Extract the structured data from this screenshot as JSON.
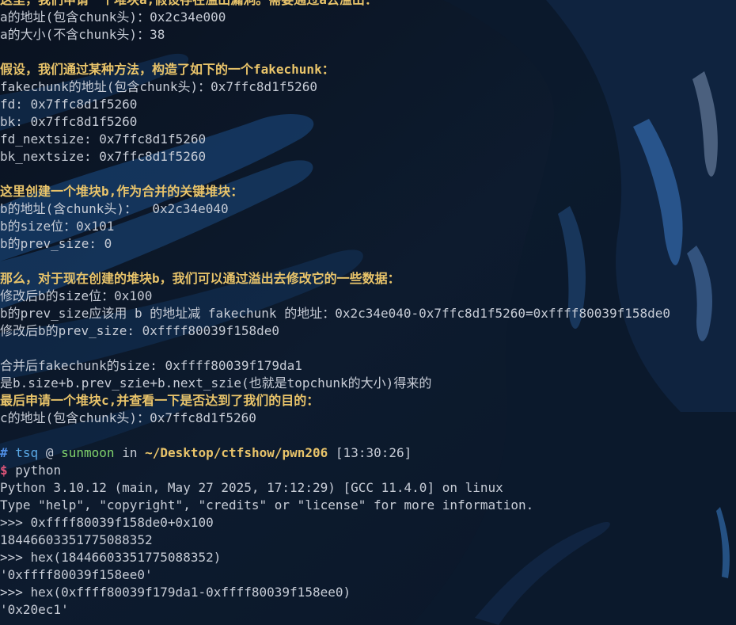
{
  "theme": {
    "background": "#0b1524",
    "text": "#c7ccd6",
    "highlight": "#e9c46a",
    "prompt_hash": "#4f8fe6",
    "prompt_user": "#5aa9e6",
    "prompt_host": "#7fd16b",
    "prompt_dollar": "#e0567a"
  },
  "output": {
    "l1": "这里，我们申请一个堆块a,假设存在溢出漏洞。需要通过a去溢出：",
    "l2": "a的地址(包含chunk头)：0x2c34e000",
    "l3": "a的大小(不含chunk头)：38",
    "l4": "假设，我们通过某种方法，构造了如下的一个fakechunk：",
    "l5": "fakechunk的地址(包含chunk头)：0x7ffc8d1f5260",
    "l6": "fd: 0x7ffc8d1f5260",
    "l7": "bk: 0x7ffc8d1f5260",
    "l8": "fd_nextsize: 0x7ffc8d1f5260",
    "l9": "bk_nextsize: 0x7ffc8d1f5260",
    "l10": "这里创建一个堆块b,作为合并的关键堆块：",
    "l11": "b的地址(含chunk头)：  0x2c34e040",
    "l12": "b的size位：0x101",
    "l13": "b的prev_size: 0",
    "l14": "那么，对于现在创建的堆块b，我们可以通过溢出去修改它的一些数据：",
    "l15": "修改后b的size位：0x100",
    "l16": "b的prev_size应该用 b 的地址减 fakechunk 的地址：0x2c34e040-0x7ffc8d1f5260=0xffff80039f158de0",
    "l17": "修改后b的prev_size: 0xffff80039f158de0",
    "l18": "合并后fakechunk的size: 0xffff80039f179da1",
    "l19": "是b.size+b.prev_szie+b.next_szie(也就是topchunk的大小)得来的",
    "l20": "最后申请一个堆块c,并查看一下是否达到了我们的目的：",
    "l21": "c的地址(包含chunk头)：0x7ffc8d1f5260"
  },
  "prompt": {
    "hash": "#",
    "user": "tsq",
    "at": "@",
    "host": "sunmoon",
    "in": "in",
    "path": "~/Desktop/ctfshow/pwn206",
    "time": "[13:30:26]",
    "dollar": "$",
    "command": "python"
  },
  "python": {
    "banner1": "Python 3.10.12 (main, May 27 2025, 17:12:29) [GCC 11.4.0] on linux",
    "banner2": "Type \"help\", \"copyright\", \"credits\" or \"license\" for more information.",
    "prompt": ">>> ",
    "in1": "0xffff80039f158de0+0x100",
    "out1": "18446603351775088352",
    "in2": "hex(18446603351775088352)",
    "out2": "'0xffff80039f158ee0'",
    "in3": "hex(0xffff80039f179da1-0xffff80039f158ee0)",
    "out3": "'0x20ec1'"
  }
}
